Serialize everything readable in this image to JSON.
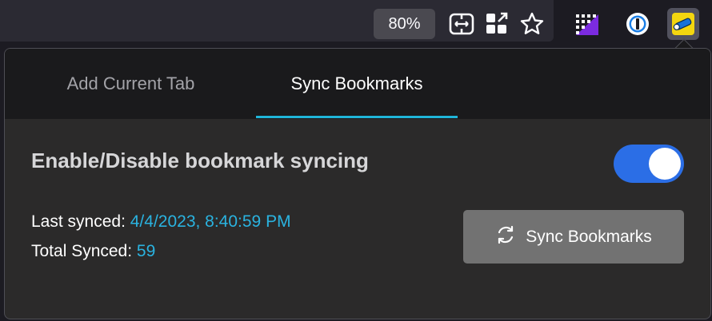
{
  "toolbar": {
    "zoom_level": "80%",
    "icons": [
      "reader-view-icon",
      "extensions-grid-icon",
      "bookmark-star-icon",
      "extension-pattern-icon",
      "password-manager-icon",
      "bookmark-sync-extension-icon"
    ]
  },
  "popup": {
    "tabs": [
      {
        "label": "Add Current Tab",
        "active": false
      },
      {
        "label": "Sync Bookmarks",
        "active": true
      }
    ],
    "setting_label": "Enable/Disable bookmark syncing",
    "toggle_enabled": true,
    "last_synced_label": "Last synced:",
    "last_synced_value": "4/4/2023, 8:40:59 PM",
    "total_synced_label": "Total Synced:",
    "total_synced_value": "59",
    "sync_button_label": "Sync Bookmarks"
  },
  "colors": {
    "accent": "#1fb5d9",
    "toggle_on": "#2b6ee6",
    "value_text": "#2ab3e0"
  }
}
